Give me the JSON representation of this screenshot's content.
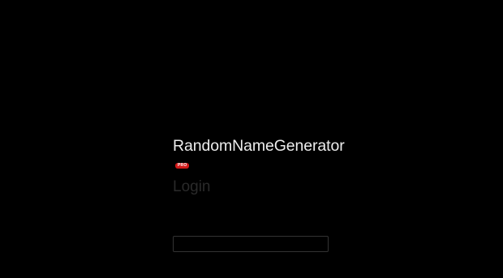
{
  "app": {
    "brand_name": "RandomNameGenerator",
    "badge": "PRO"
  },
  "login": {
    "title": "Login",
    "username_label": "",
    "username_value": "",
    "password_label": "",
    "forgot_link": ""
  },
  "colors": {
    "background": "#000000",
    "badge": "#d11a1a"
  }
}
